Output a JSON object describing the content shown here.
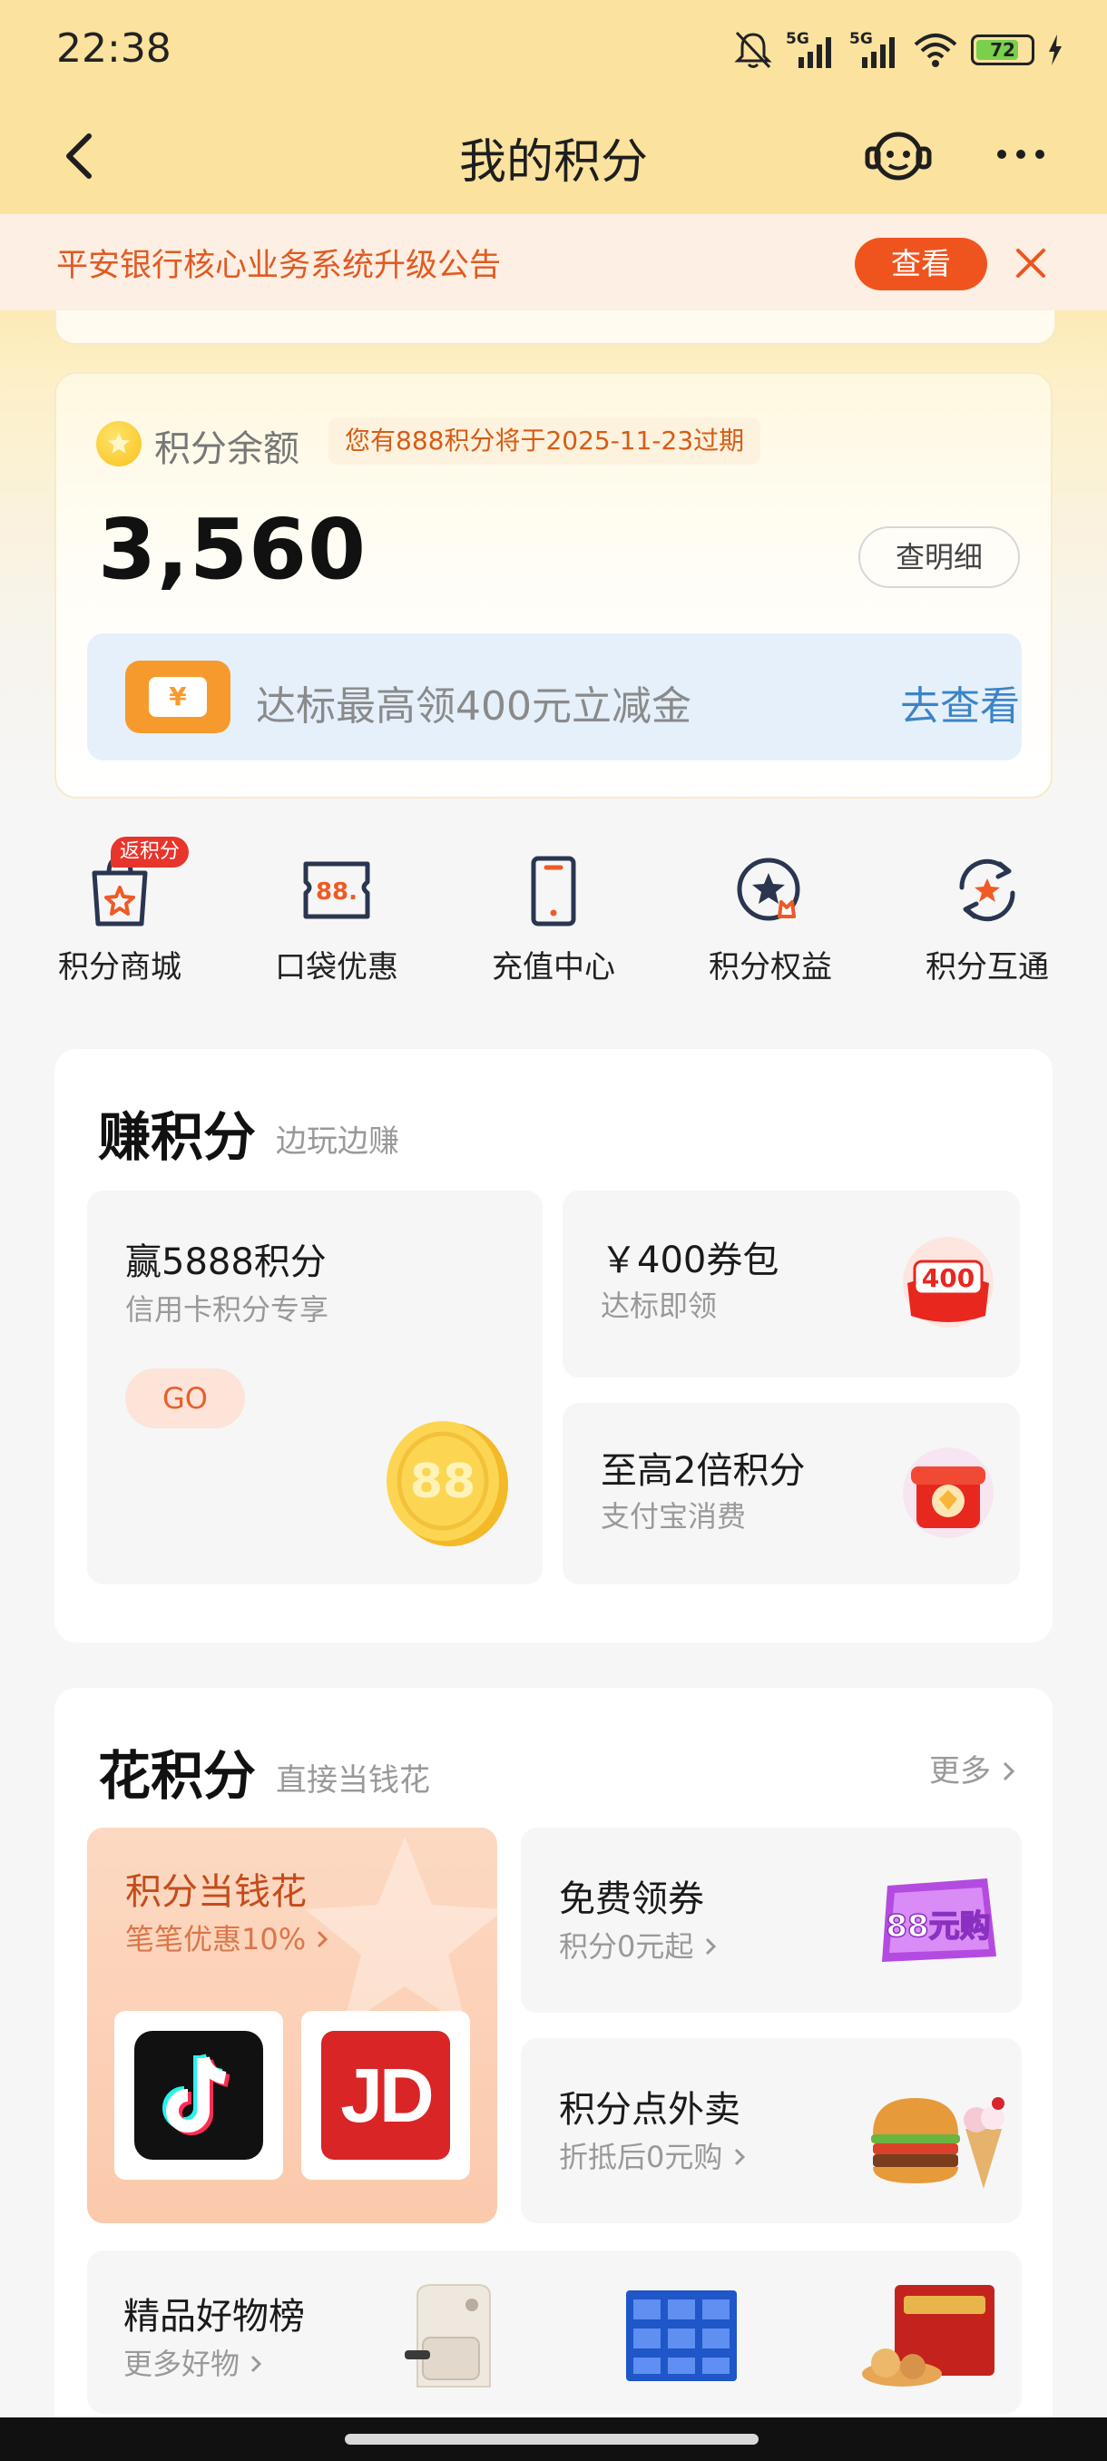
{
  "status_bar": {
    "time": "22:38",
    "network_1": "5G",
    "network_2": "5G",
    "battery": "72"
  },
  "header": {
    "title": "我的积分"
  },
  "notice": {
    "text": "平安银行核心业务系统升级公告",
    "button": "查看"
  },
  "balance": {
    "label": "积分余额",
    "expire_note": "您有888积分将于2025-11-23过期",
    "value": "3,560",
    "detail_button": "查明细",
    "promo_icon": "¥",
    "promo_text": "达标最高领400元立减金",
    "promo_link": "去查看"
  },
  "shortcuts": [
    {
      "label": "积分商城",
      "icon": "shopping-bag-star-icon",
      "badge": "返积分"
    },
    {
      "label": "口袋优惠",
      "icon": "coupon-88-icon",
      "icon_text": "88."
    },
    {
      "label": "充值中心",
      "icon": "phone-icon"
    },
    {
      "label": "积分权益",
      "icon": "star-badge-icon"
    },
    {
      "label": "积分互通",
      "icon": "exchange-star-icon"
    }
  ],
  "earn": {
    "title": "赚积分",
    "subtitle": "边玩边赚",
    "tiles": [
      {
        "title": "赢5888积分",
        "subtitle": "信用卡积分专享",
        "button": "GO",
        "image_text": "88",
        "icon": "gold-coin-icon"
      },
      {
        "title": "￥400券包",
        "subtitle": "达标即领",
        "image_text": "400",
        "icon": "coupon-badge-icon"
      },
      {
        "title": "至高2倍积分",
        "subtitle": "支付宝消费",
        "icon": "red-gift-icon"
      }
    ]
  },
  "spend": {
    "title": "花积分",
    "subtitle": "直接当钱花",
    "more": "更多",
    "hot": {
      "title": "积分当钱花",
      "subtitle": "笔笔优惠10%",
      "apps": [
        {
          "name": "tiktok",
          "icon": "tiktok-logo-icon"
        },
        {
          "name": "jd",
          "icon": "jd-logo-icon",
          "text": "JD"
        }
      ]
    },
    "tiles": [
      {
        "title": "免费领券",
        "subtitle": "积分0元起",
        "image_text": "88元购",
        "icon": "88-purchase-badge-icon"
      },
      {
        "title": "积分点外卖",
        "subtitle": "折抵后0元购",
        "icon": "burger-icecream-icon"
      }
    ],
    "best": {
      "title": "精品好物榜",
      "subtitle": "更多好物",
      "products": [
        "air-fryer-icon",
        "tissue-pack-icon",
        "snack-gift-box-icon"
      ]
    }
  },
  "colors": {
    "header_bg": "#fbe29e",
    "accent_orange": "#f0541e",
    "link_blue": "#3d84c6"
  }
}
